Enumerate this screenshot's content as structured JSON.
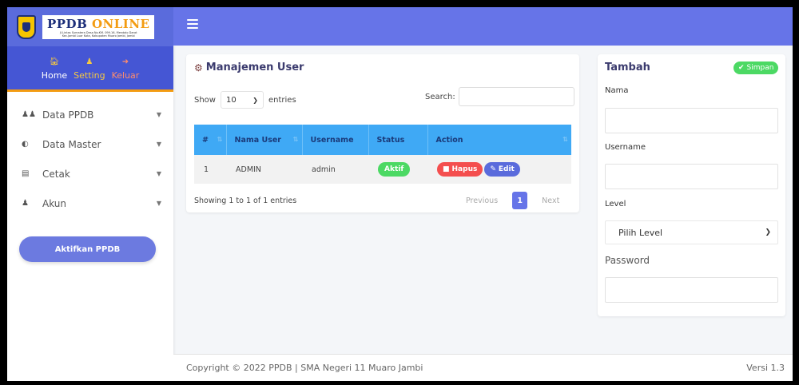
{
  "brand": {
    "title_a": "PPDB",
    "title_b": "ONLINE",
    "address_line1": "Jl.Lintas Sumatera Desa No.KM. 099.16, Mendalo Darat",
    "address_line2": "Kec.Jambi Luar Kota, Kabupaten Muaro Jambi, Jambi"
  },
  "topnav": {
    "home": {
      "label": "Home",
      "icon": "home-icon"
    },
    "setting": {
      "label": "Setting",
      "icon": "users-cog-icon"
    },
    "keluar": {
      "label": "Keluar",
      "icon": "sign-out-icon"
    }
  },
  "sidebar": {
    "items": [
      {
        "label": "Data PPDB",
        "icon": "users-icon"
      },
      {
        "label": "Data Master",
        "icon": "contrast-icon"
      },
      {
        "label": "Cetak",
        "icon": "print-icon"
      },
      {
        "label": "Akun",
        "icon": "user-icon"
      }
    ],
    "aktifkan_label": "Aktifkan PPDB"
  },
  "header": {
    "menu_icon": "hamburger-icon"
  },
  "user_card": {
    "title": "Manajemen User",
    "show_label": "Show",
    "entries_value": "10",
    "entries_label": "entries",
    "search_label": "Search:",
    "columns": [
      "#",
      "Nama User",
      "Username",
      "Status",
      "Action"
    ],
    "rows": [
      {
        "no": "1",
        "nama": "ADMIN",
        "username": "admin",
        "status": "Aktif"
      }
    ],
    "hapus_label": "Hapus",
    "edit_label": "Edit",
    "info": "Showing 1 to 1 of 1 entries",
    "prev_label": "Previous",
    "page": "1",
    "next_label": "Next"
  },
  "form_card": {
    "title": "Tambah",
    "simpan_label": "Simpan",
    "nama_label": "Nama",
    "username_label": "Username",
    "level_label": "Level",
    "level_value": "Pilih Level",
    "password_label": "Password"
  },
  "footer": {
    "copyright": "Copyright © 2022 PPDB | SMA Negeri 11 Muaro Jambi",
    "version": "Versi 1.3"
  },
  "colors": {
    "primary": "#6674e8",
    "success": "#4cd964",
    "danger": "#f44e4e",
    "table_header": "#3fa9f5"
  }
}
